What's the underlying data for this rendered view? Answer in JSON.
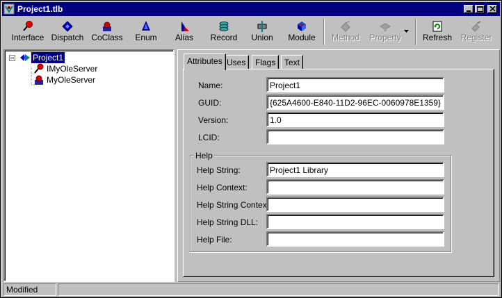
{
  "window": {
    "title": "Project1.tlb"
  },
  "toolbar": {
    "buttons": [
      {
        "label": "Interface",
        "icon": "interface-icon",
        "enabled": true
      },
      {
        "label": "Dispatch",
        "icon": "dispatch-icon",
        "enabled": true
      },
      {
        "label": "CoClass",
        "icon": "coclass-icon",
        "enabled": true
      },
      {
        "label": "Enum",
        "icon": "enum-icon",
        "enabled": true
      },
      {
        "label": "Alias",
        "icon": "alias-icon",
        "enabled": true
      },
      {
        "label": "Record",
        "icon": "record-icon",
        "enabled": true
      },
      {
        "label": "Union",
        "icon": "union-icon",
        "enabled": true
      },
      {
        "label": "Module",
        "icon": "module-icon",
        "enabled": true
      },
      {
        "label": "Method",
        "icon": "method-icon",
        "enabled": false
      },
      {
        "label": "Property",
        "icon": "property-icon",
        "enabled": false
      },
      {
        "label": "Refresh",
        "icon": "refresh-icon",
        "enabled": true
      },
      {
        "label": "Register",
        "icon": "register-icon",
        "enabled": false
      }
    ]
  },
  "tree": {
    "root": {
      "label": "Project1",
      "icon": "library-icon",
      "expanded": true,
      "selected": true
    },
    "children": [
      {
        "label": "IMyOleServer",
        "icon": "interface-icon"
      },
      {
        "label": "MyOleServer",
        "icon": "coclass-icon"
      }
    ]
  },
  "tabs": [
    {
      "label": "Attributes",
      "active": true
    },
    {
      "label": "Uses",
      "active": false
    },
    {
      "label": "Flags",
      "active": false
    },
    {
      "label": "Text",
      "active": false
    }
  ],
  "attributes": {
    "name_label": "Name:",
    "name_value": "Project1",
    "guid_label": "GUID:",
    "guid_value": "{625A4600-E840-11D2-96EC-0060978E1359}",
    "version_label": "Version:",
    "version_value": "1.0",
    "lcid_label": "LCID:",
    "lcid_value": ""
  },
  "help": {
    "group_title": "Help",
    "help_string_label": "Help String:",
    "help_string_value": "Project1 Library",
    "help_context_label": "Help Context:",
    "help_context_value": "",
    "help_string_context_label": "Help String Context:",
    "help_string_context_value": "",
    "help_string_dll_label": "Help String DLL:",
    "help_string_dll_value": "",
    "help_file_label": "Help File:",
    "help_file_value": ""
  },
  "statusbar": {
    "status_text": "Modified",
    "secondary_text": ""
  },
  "colors": {
    "titlebar": "#000080",
    "face": "#c0c0c0",
    "selection": "#000080"
  }
}
